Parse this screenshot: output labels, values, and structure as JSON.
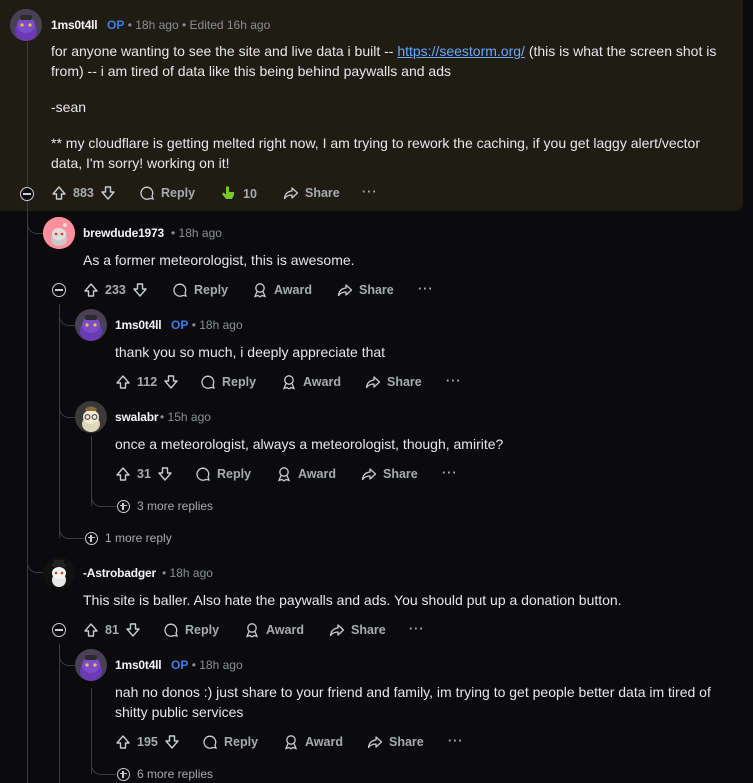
{
  "comments": [
    {
      "username": "1ms0t4ll",
      "op": "OP",
      "time": "18h ago",
      "edited": "Edited 16h ago",
      "body_before_link": "for anyone wanting to see the site and live data i built -- ",
      "link": "https://seestorm.org/",
      "body_after_link": " (this is what the screen shot is from) -- i am tired of data like this being behind paywalls and ads",
      "signoff": "-sean",
      "note": "** my cloudflare is getting melted right now, I am trying to rework the caching, if you get laggy alert/vector data, I'm sorry! working on it!",
      "votes": "883",
      "reply": "Reply",
      "award_count": "10",
      "share": "Share",
      "more": "···"
    },
    {
      "username": "brewdude1973",
      "time": "18h ago",
      "body": "As a former meteorologist, this is awesome.",
      "votes": "233",
      "reply": "Reply",
      "award": "Award",
      "share": "Share",
      "more": "···"
    },
    {
      "username": "1ms0t4ll",
      "op": "OP",
      "time": "18h ago",
      "body": "thank you so much, i deeply appreciate that",
      "votes": "112",
      "reply": "Reply",
      "award": "Award",
      "share": "Share",
      "more": "···"
    },
    {
      "username": "swalabr",
      "time": "15h ago",
      "body": "once a meteorologist, always a meteorologist, though, amirite?",
      "votes": "31",
      "reply": "Reply",
      "award": "Award",
      "share": "Share",
      "more": "···"
    },
    {
      "username": "-Astrobadger",
      "time": "18h ago",
      "body": "This site is baller. Also hate the paywalls and ads. You should put up a donation button.",
      "votes": "81",
      "reply": "Reply",
      "award": "Award",
      "share": "Share",
      "more": "···"
    },
    {
      "username": "1ms0t4ll",
      "op": "OP",
      "time": "18h ago",
      "body": "nah no donos :) just share to your friend and family, im trying to get people better data im tired of shitty public services",
      "votes": "195",
      "reply": "Reply",
      "award": "Award",
      "share": "Share",
      "more": "···"
    }
  ],
  "more_replies": {
    "swalabr": "3 more replies",
    "brewdude": "1 more reply",
    "astro": "6 more replies"
  },
  "colors": {
    "background": "#0b0b0d",
    "highlight": "#1f1c14",
    "op": "#3f7fe3",
    "link": "#6ea8ff",
    "award_hand": "#7cc52a"
  }
}
